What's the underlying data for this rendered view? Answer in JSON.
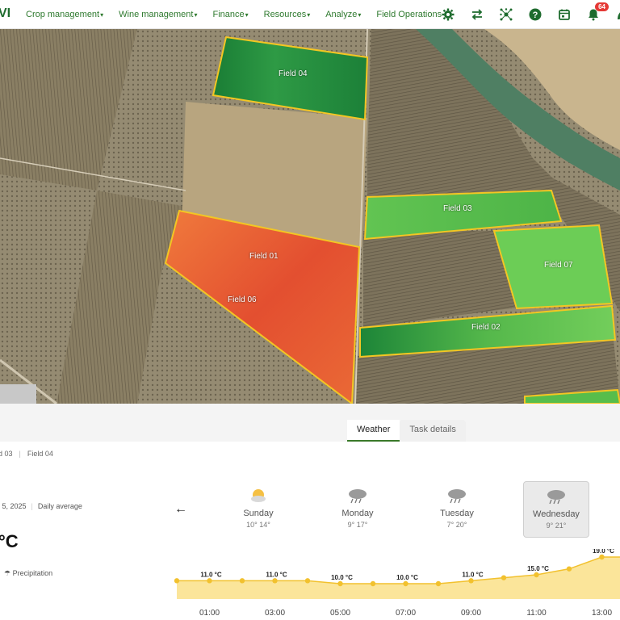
{
  "nav": {
    "logo": "VI",
    "menu": [
      {
        "label": "Crop management",
        "caret": true
      },
      {
        "label": "Wine management",
        "caret": true
      },
      {
        "label": "Finance",
        "caret": true
      },
      {
        "label": "Resources",
        "caret": true
      },
      {
        "label": "Analyze",
        "caret": true
      },
      {
        "label": "Field Operations",
        "caret": false
      }
    ],
    "icons": [
      "gear-icon",
      "swap-icon",
      "network-icon",
      "help-icon",
      "calendar-icon",
      "bell-icon"
    ],
    "notification_count": "64"
  },
  "map": {
    "fields": [
      {
        "name": "Field 04",
        "color": "#1f8b3b"
      },
      {
        "name": "Field 03",
        "color": "#5cc04f"
      },
      {
        "name": "Field 07",
        "color": "#6dcc55"
      },
      {
        "name": "Field 02",
        "color": "#3fae45"
      },
      {
        "name": "Field 01",
        "color": "#e9533a"
      },
      {
        "name": "Field 06",
        "color": "#e0442f"
      }
    ]
  },
  "tabs": [
    {
      "label": "Weather",
      "active": true
    },
    {
      "label": "Task details",
      "active": false
    }
  ],
  "breadcrumbs": [
    "ld 03",
    "Field 04"
  ],
  "date_label": "r 5, 2025",
  "daily_average": "Daily average",
  "current_temp": "°C",
  "precipitation_label": "Precipitation",
  "days": [
    {
      "name": "Sunday",
      "range": "10° 14°",
      "icon": "sun-cloud-icon",
      "selected": false
    },
    {
      "name": "Monday",
      "range": "9° 17°",
      "icon": "cloud-rain-icon",
      "selected": false
    },
    {
      "name": "Tuesday",
      "range": "7° 20°",
      "icon": "cloud-rain-icon",
      "selected": false
    },
    {
      "name": "Wednesday",
      "range": "9° 21°",
      "icon": "cloud-rain-icon",
      "selected": true
    }
  ],
  "chart_data": {
    "type": "area",
    "x": [
      "00:00",
      "01:00",
      "02:00",
      "03:00",
      "04:00",
      "05:00",
      "06:00",
      "07:00",
      "08:00",
      "09:00",
      "10:00",
      "11:00",
      "12:00",
      "13:00",
      "14:00"
    ],
    "tick_labels": [
      "01:00",
      "03:00",
      "05:00",
      "07:00",
      "09:00",
      "11:00",
      "13:00"
    ],
    "values": [
      11.0,
      11.0,
      11.0,
      11.0,
      11.0,
      10.0,
      10.0,
      10.0,
      10.0,
      11.0,
      12.0,
      13.0,
      15.0,
      19.0,
      19.0
    ],
    "data_labels": [
      {
        "x": "01:00",
        "label": "11.0 °C"
      },
      {
        "x": "03:00",
        "label": "11.0 °C"
      },
      {
        "x": "05:00",
        "label": "10.0 °C"
      },
      {
        "x": "07:00",
        "label": "10.0 °C"
      },
      {
        "x": "09:00",
        "label": "11.0 °C"
      },
      {
        "x": "11:00",
        "label": "15.0 °C"
      },
      {
        "x": "13:00",
        "label": "19.0 °C"
      }
    ],
    "color": "#f2c12e"
  }
}
